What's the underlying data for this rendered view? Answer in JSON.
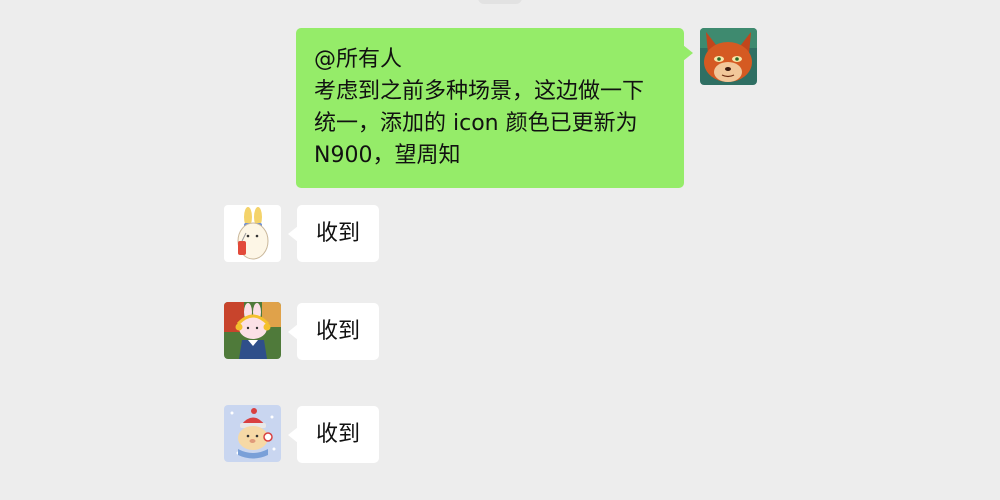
{
  "messages": [
    {
      "direction": "outgoing",
      "lines": [
        "@所有人",
        "考虑到之前多种场景，这边做一下",
        "统一，添加的 icon 颜色已更新为",
        "N900，望周知"
      ],
      "avatar": "fox-avatar",
      "bubble_color": "#95ec69"
    },
    {
      "direction": "incoming",
      "text": "收到",
      "avatar": "bunny-with-drink-avatar"
    },
    {
      "direction": "incoming",
      "text": "收到",
      "avatar": "bunny-with-headphones-avatar"
    },
    {
      "direction": "incoming",
      "text": "收到",
      "avatar": "bear-with-beanie-avatar"
    }
  ],
  "colors": {
    "background": "#ededed",
    "outgoing_bubble": "#95ec69",
    "incoming_bubble": "#ffffff"
  }
}
